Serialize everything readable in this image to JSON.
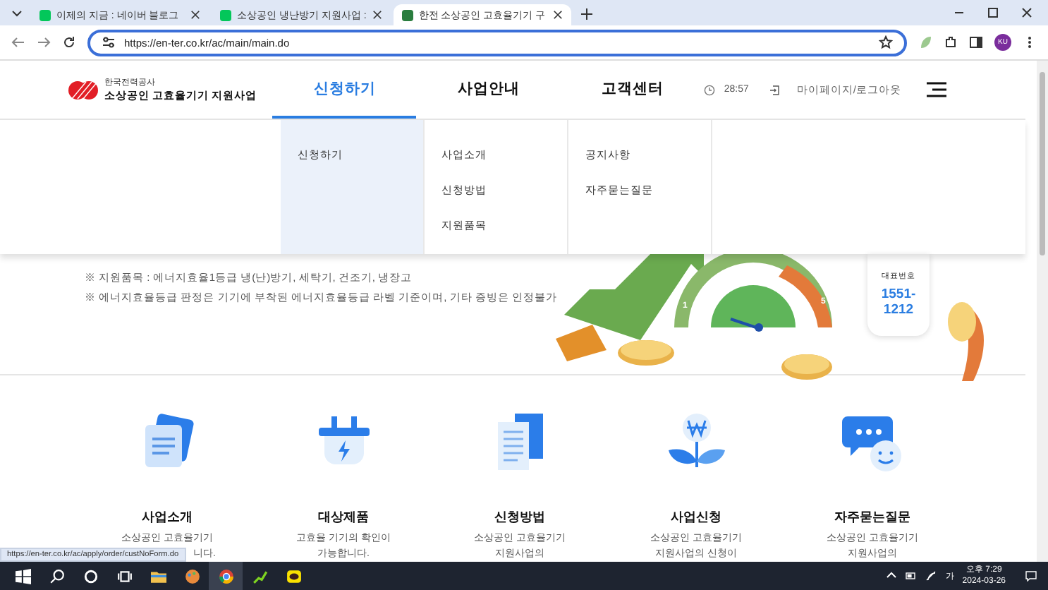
{
  "browser": {
    "tabs": [
      {
        "title": "이제의 지금 : 네이버 블로그",
        "selected": false,
        "color": "#03c75a"
      },
      {
        "title": "소상공인 냉난방기 지원사업 :",
        "selected": false,
        "color": "#03c75a"
      },
      {
        "title": "한전 소상공인 고효율기기 구",
        "selected": true,
        "color": "#2a7d3e"
      }
    ],
    "url": "https://en-ter.co.kr/ac/main/main.do",
    "profile": "KU"
  },
  "header": {
    "org": "한국전력공사",
    "title": "소상공인 고효율기기 지원사업",
    "nav": [
      {
        "label": "신청하기",
        "selected": true
      },
      {
        "label": "사업안내",
        "selected": false
      },
      {
        "label": "고객센터",
        "selected": false
      }
    ],
    "timer": "28:57",
    "account": "마이페이지/로그아웃"
  },
  "dropdown": [
    {
      "items": [
        "신청하기"
      ],
      "selected": true
    },
    {
      "items": [
        "사업소개",
        "신청방법",
        "지원품목"
      ],
      "selected": false
    },
    {
      "items": [
        "공지사항",
        "자주묻는질문"
      ],
      "selected": false
    }
  ],
  "hero": {
    "notes": [
      "※ 지원품목 : 에너지효율1등급 냉(난)방기, 세탁기, 건조기, 냉장고",
      "※ 에너지효율등급 판정은 기기에 부착된 에너지효율등급 라벨 기준이며, 기타 증빙은 인정불가"
    ],
    "gauge_labels": [
      "1",
      "5"
    ],
    "phone_label": "대표번호",
    "phone_lines": [
      "1551-",
      "1212"
    ]
  },
  "cards": [
    {
      "kind": "docs",
      "title": "사업소개",
      "desc": [
        {
          "text": "소상공인 고효율기기",
          "cut": false
        },
        {
          "text": "니다.",
          "cut": true
        }
      ]
    },
    {
      "kind": "plug",
      "title": "대상제품",
      "desc": [
        {
          "text": "고효율 기기의 확인이",
          "cut": false
        },
        {
          "text": "가능합니다.",
          "cut": false
        }
      ]
    },
    {
      "kind": "paper",
      "title": "신청방법",
      "desc": [
        {
          "text": "소상공인 고효율기기",
          "cut": false
        },
        {
          "text": "지원사업의",
          "cut": false
        }
      ]
    },
    {
      "kind": "plant",
      "title": "사업신청",
      "desc": [
        {
          "text": "소상공인 고효율기기",
          "cut": false
        },
        {
          "text": "지원사업의 신청이",
          "cut": false
        }
      ]
    },
    {
      "kind": "chat",
      "title": "자주묻는질문",
      "desc": [
        {
          "text": "소상공인 고효율기기",
          "cut": false
        },
        {
          "text": "지원사업의",
          "cut": false
        }
      ]
    }
  ],
  "status_url": "https://en-ter.co.kr/ac/apply/order/custNoForm.do",
  "taskbar": {
    "ime": "가",
    "time": "오후 7:29",
    "date": "2024-03-26"
  }
}
